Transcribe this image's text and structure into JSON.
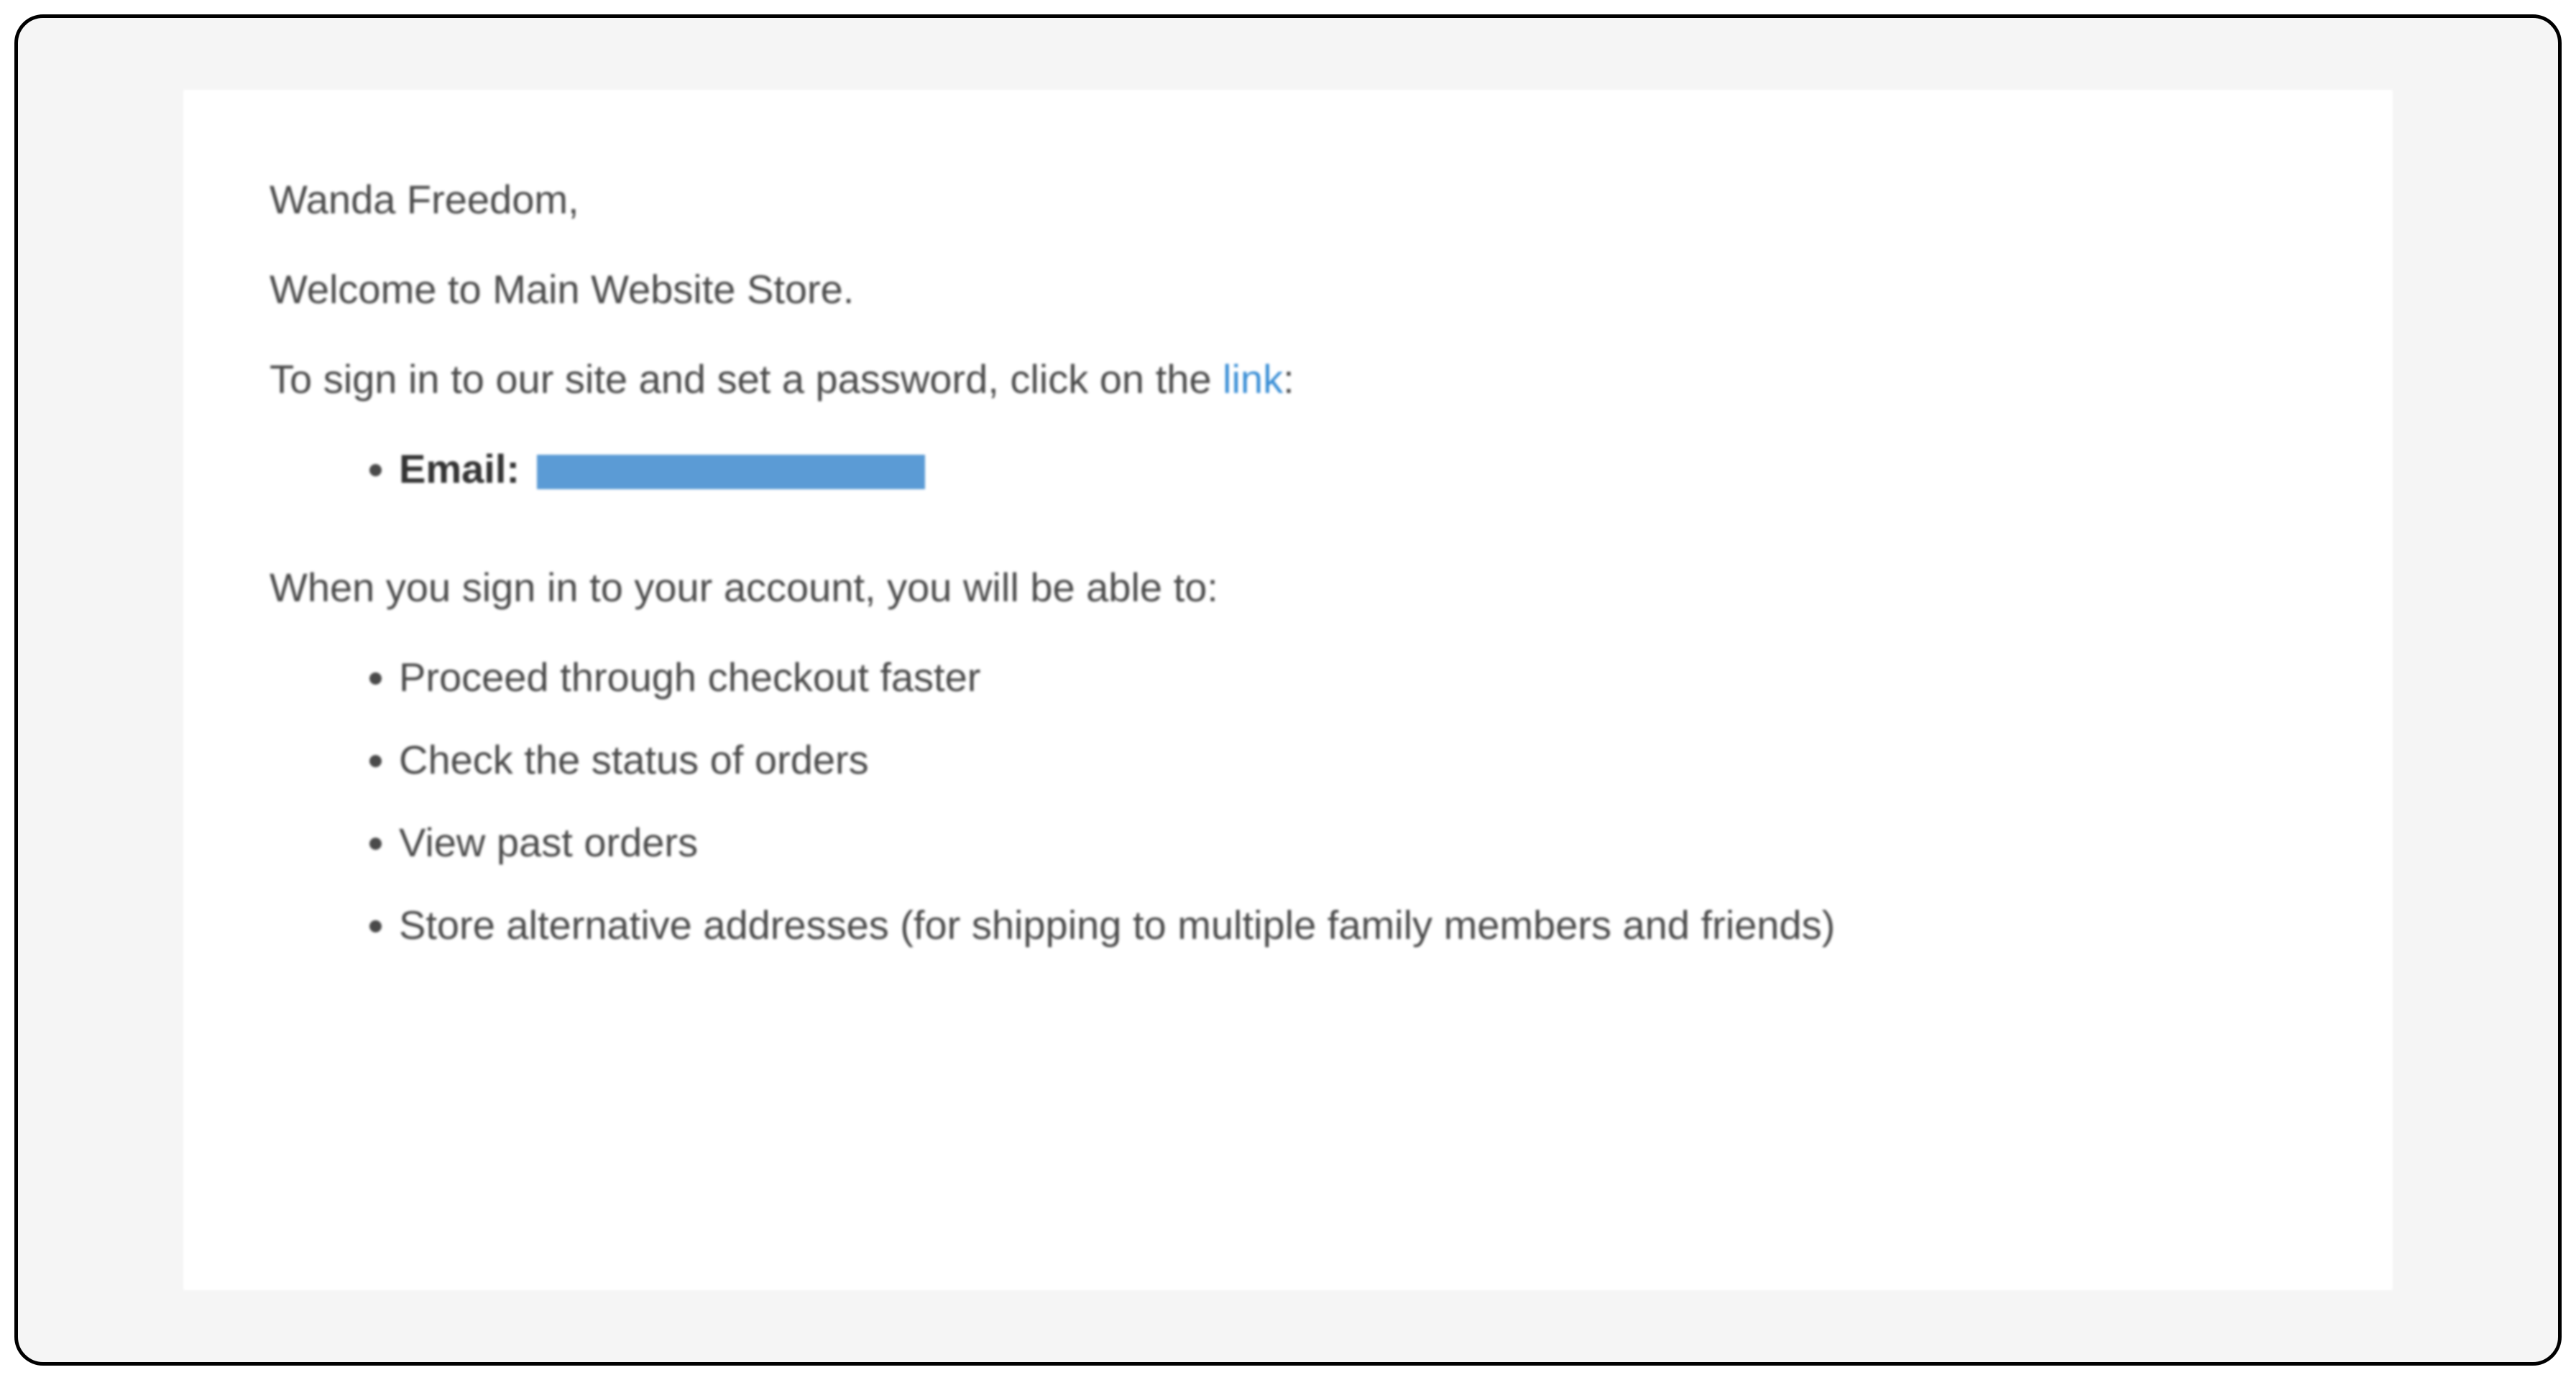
{
  "email": {
    "greeting": "Wanda Freedom,",
    "welcome": "Welcome to Main Website Store.",
    "signin_prefix": "To sign in to our site and set a password, click on the ",
    "link_text": "link",
    "signin_suffix": ":",
    "email_label": "Email:",
    "email_value_redacted": true,
    "ability_intro": "When you sign in to your account, you will be able to:",
    "benefits": [
      "Proceed through checkout faster",
      "Check the status of orders",
      "View past orders",
      "Store alternative addresses (for shipping to multiple family members and friends)"
    ]
  }
}
